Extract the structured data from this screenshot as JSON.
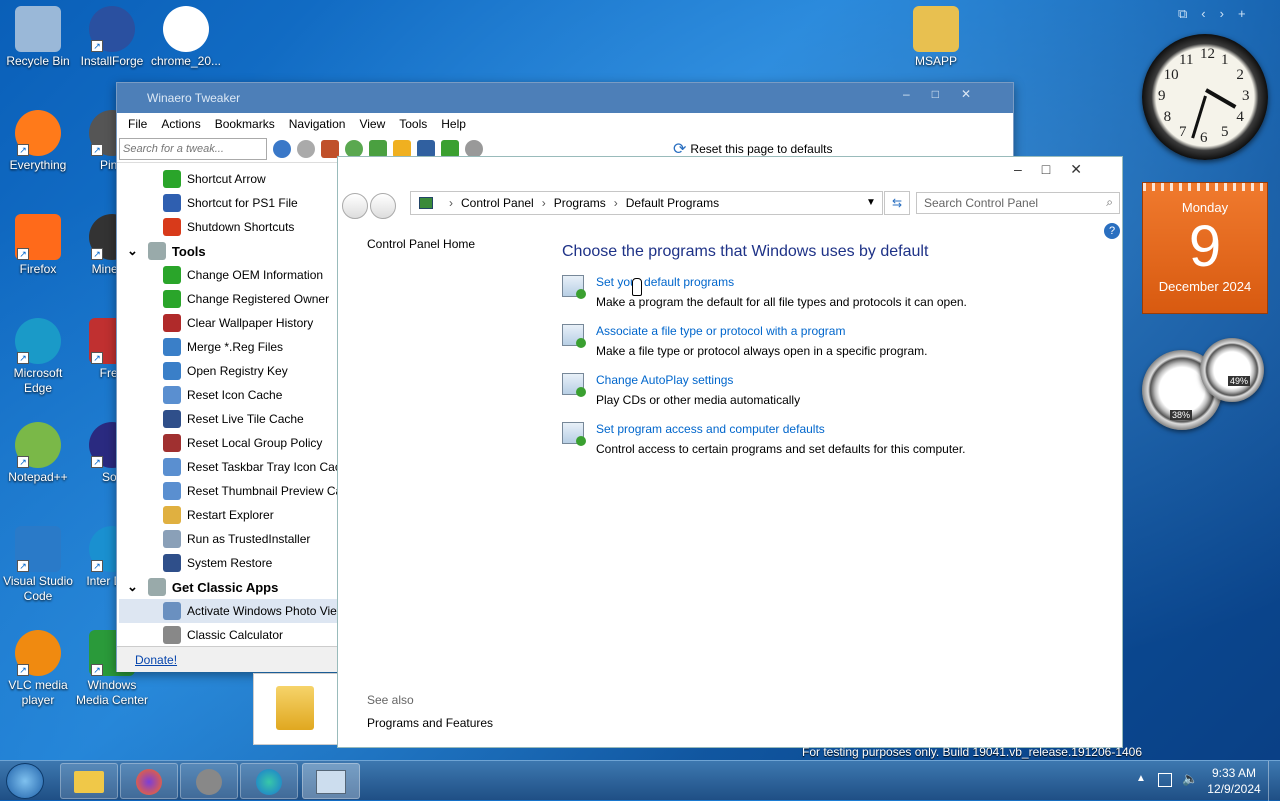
{
  "desktop": {
    "icons": [
      {
        "label": "Recycle Bin"
      },
      {
        "label": "InstallForge"
      },
      {
        "label": "chrome_20..."
      },
      {
        "label": "MSAPP"
      },
      {
        "label": "Everything"
      },
      {
        "label": "Pinb"
      },
      {
        "label": "Firefox"
      },
      {
        "label": "Minesw"
      },
      {
        "label": "Microsoft Edge"
      },
      {
        "label": "Free"
      },
      {
        "label": "Notepad++"
      },
      {
        "label": "Soli"
      },
      {
        "label": "Visual Studio Code"
      },
      {
        "label": "Inter Dow"
      },
      {
        "label": "VLC media player"
      },
      {
        "label": "Windows Media Center"
      }
    ]
  },
  "gadgets": {
    "clock_numbers": [
      "12",
      "1",
      "2",
      "3",
      "4",
      "5",
      "6",
      "7",
      "8",
      "9",
      "10",
      "11"
    ],
    "calendar": {
      "weekday": "Monday",
      "day": "9",
      "month_year": "December 2024"
    },
    "meter": {
      "cpu": "38%",
      "mem": "49%"
    }
  },
  "tweaker": {
    "title": "Winaero Tweaker",
    "menu": [
      "File",
      "Actions",
      "Bookmarks",
      "Navigation",
      "View",
      "Tools",
      "Help"
    ],
    "search_placeholder": "Search for a tweak...",
    "reset_label": "Reset this page to defaults",
    "tree": [
      {
        "label": "Shortcut Arrow",
        "type": "item",
        "color": "#2aa52a"
      },
      {
        "label": "Shortcut for PS1 File",
        "type": "item",
        "color": "#2f5fb0"
      },
      {
        "label": "Shutdown Shortcuts",
        "type": "item",
        "color": "#d83a1a"
      },
      {
        "label": "Tools",
        "type": "head"
      },
      {
        "label": "Change OEM Information",
        "type": "item",
        "color": "#2aa52a"
      },
      {
        "label": "Change Registered Owner",
        "type": "item",
        "color": "#2aa52a"
      },
      {
        "label": "Clear Wallpaper History",
        "type": "item",
        "color": "#b02a2a"
      },
      {
        "label": "Merge *.Reg Files",
        "type": "item",
        "color": "#3a7fc8"
      },
      {
        "label": "Open Registry Key",
        "type": "item",
        "color": "#3a7fc8"
      },
      {
        "label": "Reset Icon Cache",
        "type": "item",
        "color": "#5a8fd0"
      },
      {
        "label": "Reset Live Tile Cache",
        "type": "item",
        "color": "#2f4f8a"
      },
      {
        "label": "Reset Local Group Policy",
        "type": "item",
        "color": "#a03030"
      },
      {
        "label": "Reset Taskbar Tray Icon Cache",
        "type": "item",
        "color": "#5a8fd0"
      },
      {
        "label": "Reset Thumbnail Preview Cach",
        "type": "item",
        "color": "#5a8fd0"
      },
      {
        "label": "Restart Explorer",
        "type": "item",
        "color": "#e0b040"
      },
      {
        "label": "Run as TrustedInstaller",
        "type": "item",
        "color": "#8aa0b8"
      },
      {
        "label": "System Restore",
        "type": "item",
        "color": "#2f4f8a"
      },
      {
        "label": "Get Classic Apps",
        "type": "head"
      },
      {
        "label": "Activate Windows Photo Viewe",
        "type": "item",
        "color": "#6a90c0",
        "selected": true
      },
      {
        "label": "Classic Calculator",
        "type": "item",
        "color": "#888"
      }
    ],
    "donate": "Donate!"
  },
  "control_panel": {
    "breadcrumb": [
      "Control Panel",
      "Programs",
      "Default Programs"
    ],
    "search_placeholder": "Search Control Panel",
    "side_home": "Control Panel Home",
    "heading": "Choose the programs that Windows uses by default",
    "tasks": [
      {
        "link": "Set your default programs",
        "desc": "Make a program the default for all file types and protocols it can open."
      },
      {
        "link": "Associate a file type or protocol with a program",
        "desc": "Make a file type or protocol always open in a specific program."
      },
      {
        "link": "Change AutoPlay settings",
        "desc": "Play CDs or other media automatically"
      },
      {
        "link": "Set program access and computer defaults",
        "desc": "Control access to certain programs and set defaults for this computer."
      }
    ],
    "see_also": "See also",
    "see_also_link": "Programs and Features"
  },
  "watermark": "For testing purposes only. Build 19041.vb_release.191206-1406",
  "taskbar": {
    "time": "9:33 AM",
    "date": "12/9/2024"
  }
}
